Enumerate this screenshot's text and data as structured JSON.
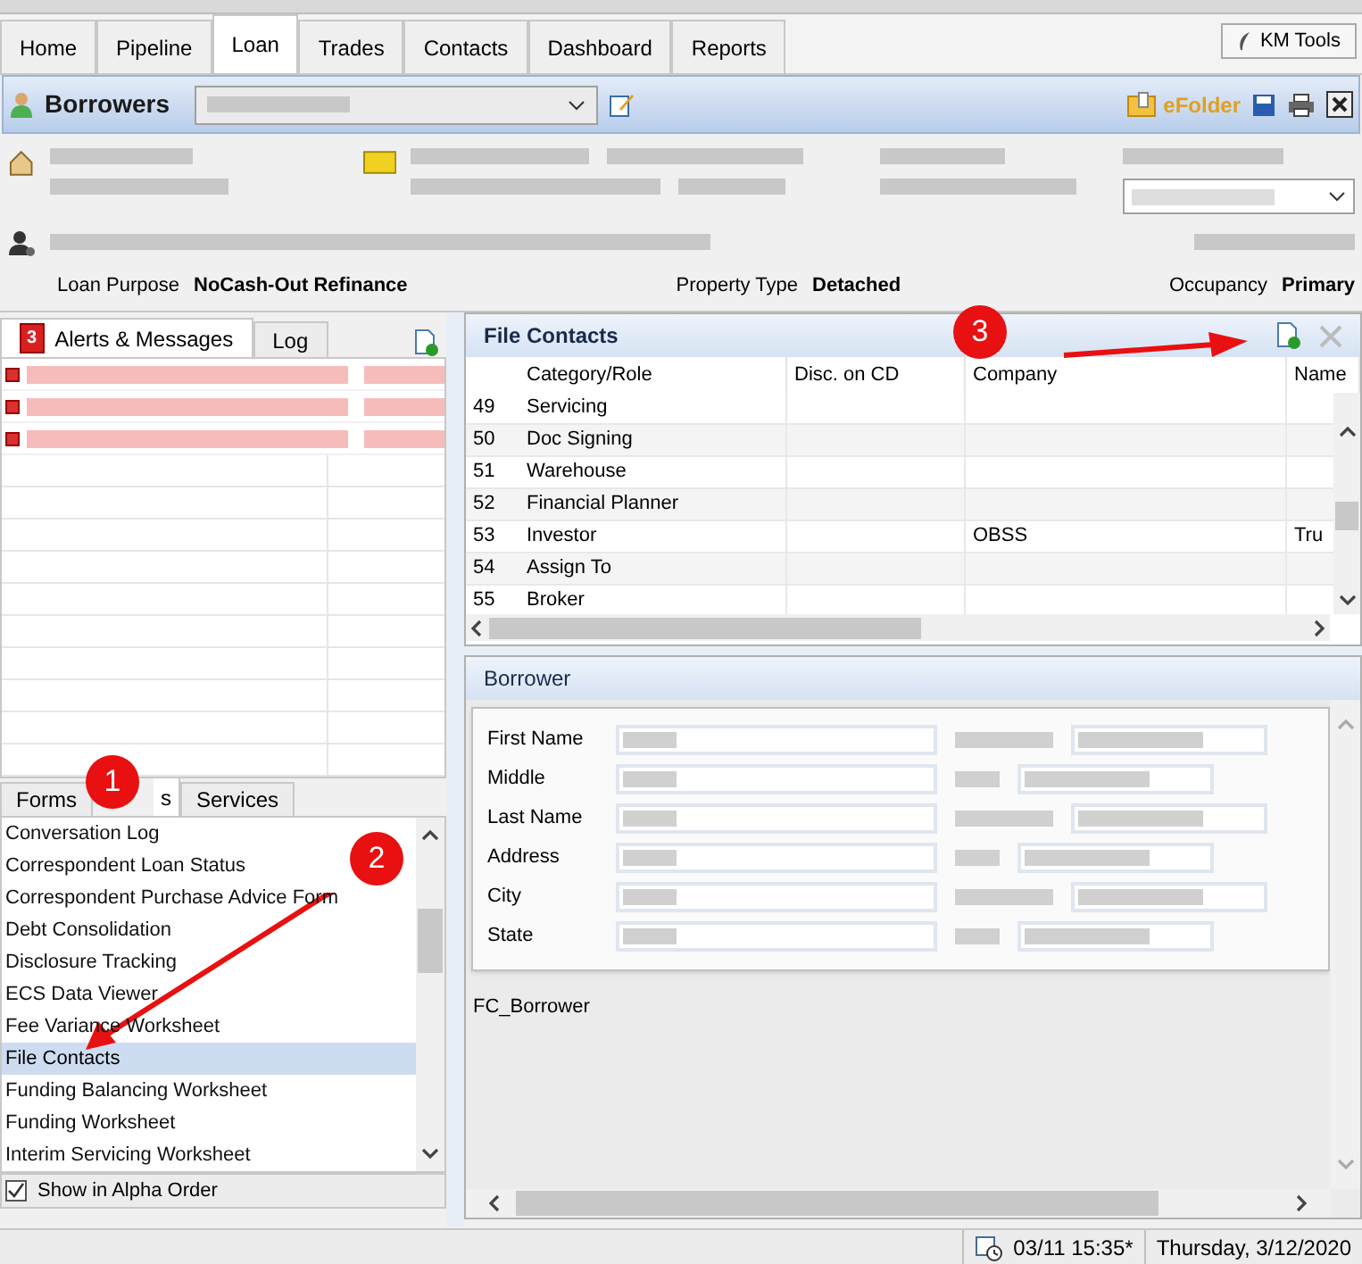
{
  "top_tabs": [
    {
      "label": "Home",
      "selected": false
    },
    {
      "label": "Pipeline",
      "selected": false
    },
    {
      "label": "Loan",
      "selected": true
    },
    {
      "label": "Trades",
      "selected": false
    },
    {
      "label": "Contacts",
      "selected": false
    },
    {
      "label": "Dashboard",
      "selected": false
    },
    {
      "label": "Reports",
      "selected": false
    }
  ],
  "tools_button": "KM Tools",
  "borrowers_bar": {
    "title": "Borrowers",
    "efolder": "eFolder"
  },
  "loan_summary": [
    {
      "label": "Loan Purpose",
      "value": "NoCash-Out Refinance"
    },
    {
      "label": "Property Type",
      "value": "Detached"
    },
    {
      "label": "Occupancy",
      "value": "Primary"
    }
  ],
  "alerts_panel": {
    "tabs": [
      {
        "label": "Alerts & Messages",
        "badge": "3",
        "selected": true
      },
      {
        "label": "Log",
        "selected": false
      }
    ]
  },
  "forms_panel": {
    "tabs": [
      {
        "label": "Forms",
        "selected": false
      },
      {
        "label": "s",
        "selected": true
      },
      {
        "label": "Services",
        "selected": false
      }
    ],
    "items": [
      {
        "label": "Conversation Log",
        "selected": false
      },
      {
        "label": "Correspondent Loan Status",
        "selected": false
      },
      {
        "label": "Correspondent Purchase Advice Form",
        "selected": false
      },
      {
        "label": "Debt Consolidation",
        "selected": false
      },
      {
        "label": "Disclosure Tracking",
        "selected": false
      },
      {
        "label": "ECS Data Viewer",
        "selected": false
      },
      {
        "label": "Fee Variance Worksheet",
        "selected": false
      },
      {
        "label": "File Contacts",
        "selected": true
      },
      {
        "label": "Funding Balancing Worksheet",
        "selected": false
      },
      {
        "label": "Funding Worksheet",
        "selected": false
      },
      {
        "label": "Interim Servicing Worksheet",
        "selected": false
      }
    ],
    "alpha_order": {
      "label": "Show in Alpha Order",
      "checked": true
    }
  },
  "file_contacts": {
    "title": "File Contacts",
    "columns": [
      "Category/Role",
      "Disc. on CD",
      "Company",
      "Name"
    ],
    "rows": [
      {
        "number": "49",
        "role": "Servicing"
      },
      {
        "number": "50",
        "role": "Doc Signing"
      },
      {
        "number": "51",
        "role": "Warehouse"
      },
      {
        "number": "52",
        "role": "Financial Planner"
      },
      {
        "number": "53",
        "role": "Investor",
        "company": "OBSS",
        "name": "Tru"
      },
      {
        "number": "54",
        "role": "Assign To"
      },
      {
        "number": "55",
        "role": "Broker"
      }
    ]
  },
  "borrower": {
    "title": "Borrower",
    "fields": [
      "First Name",
      "Middle",
      "Last Name",
      "Address",
      "City",
      "State"
    ],
    "form_id": "FC_Borrower"
  },
  "status_bar": {
    "sync_time": "03/11 15:35*",
    "date": "Thursday, 3/12/2020"
  },
  "annotations": [
    {
      "number": "1"
    },
    {
      "number": "2"
    },
    {
      "number": "3"
    }
  ]
}
